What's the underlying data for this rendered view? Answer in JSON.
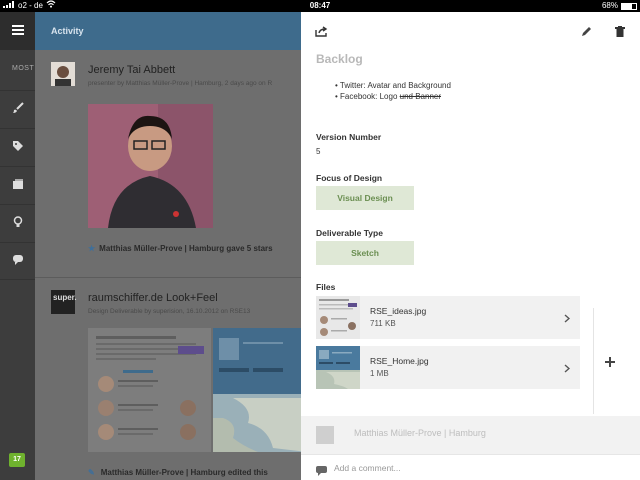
{
  "status_bar": {
    "carrier": "o2 - de",
    "time": "08:47",
    "battery": "68%",
    "battery_level": 0.68
  },
  "rail": {
    "section_label": "MOST",
    "badge_count": "17",
    "icons": [
      "menu-icon",
      "brush-icon",
      "tags-icon",
      "cards-icon",
      "lightbulb-icon",
      "chat-icon"
    ]
  },
  "feed": {
    "header": "Activity",
    "posts": [
      {
        "title": "Jeremy Tai Abbett",
        "subtitle": "presenter by Matthias Müller-Prove | Hamburg, 2 days ago on R",
        "footer": "Matthias Müller-Prove | Hamburg gave 5 stars"
      },
      {
        "title": "raumschiffer.de Look+Feel",
        "subtitle": "Design Deliverable by superision, 16.10.2012 on RSE13",
        "avatar_text": "super.",
        "footer": "Matthias Müller-Prove | Hamburg edited this"
      }
    ]
  },
  "detail": {
    "section_title": "Backlog",
    "bullets": [
      {
        "text": "Twitter: Avatar and Background",
        "struck": ""
      },
      {
        "text": "Facebook: Logo ",
        "struck": "und Banner"
      }
    ],
    "version_label": "Version Number",
    "version_value": "5",
    "focus_label": "Focus of Design",
    "focus_value": "Visual Design",
    "deliverable_label": "Deliverable Type",
    "deliverable_value": "Sketch",
    "files_label": "Files",
    "files": [
      {
        "name": "RSE_ideas.jpg",
        "size": "711 KB"
      },
      {
        "name": "RSE_Home.jpg",
        "size": "1 MB"
      }
    ],
    "comment_author": "Matthias Müller-Prove | Hamburg",
    "comment_placeholder": "Add a comment..."
  },
  "colors": {
    "feed_header": "#3e6b8c",
    "tag_bg": "#dfe8d6",
    "tag_text": "#6b8f52",
    "badge": "#6fb22e"
  }
}
